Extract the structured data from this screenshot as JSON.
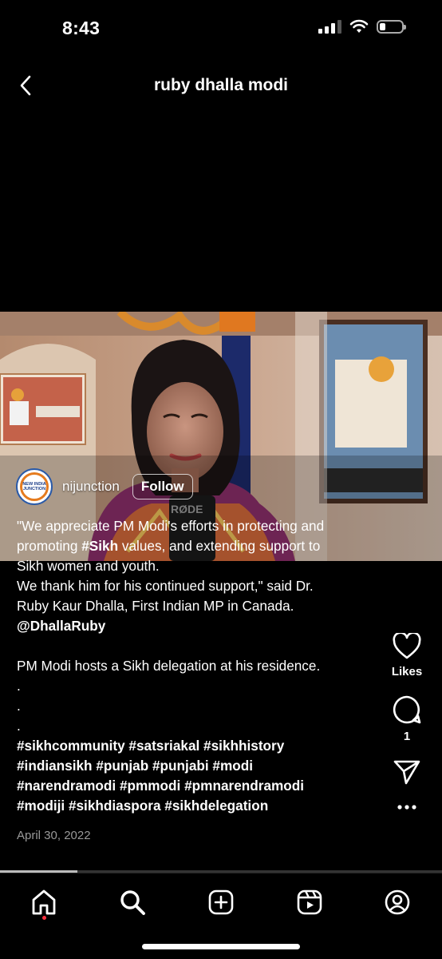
{
  "status_bar": {
    "time": "8:43",
    "signal_bars": 3,
    "battery_level": 0.25
  },
  "header": {
    "title": "ruby dhalla modi",
    "back_icon": "chevron-left-icon"
  },
  "video": {
    "mic_text": "RØDE",
    "progress": 0.175
  },
  "author": {
    "username": "nijunction",
    "follow_label": "Follow",
    "avatar_text": "NEW INDIA JUNCTION"
  },
  "caption": {
    "l1": "\"We appreciate PM Modi's efforts in protecting and",
    "l2_pre": "promoting ",
    "l2_tag": "#Sikh",
    "l2_post": " values, and extending support to",
    "l3": "Sikh women and youth.",
    "l4": "We thank him for his continued support,\" said Dr.",
    "l5": "Ruby Kaur Dhalla, First Indian MP in Canada.",
    "mention": "@DhallaRuby",
    "l7": "PM Modi hosts a Sikh delegation at his residence.",
    "dot": ".",
    "h1": "#sikhcommunity #satsriakal #sikhhistory",
    "h2": "#indiansikh #punjab #punjabi #modi",
    "h3": "#narendramodi #pmmodi #pmnarendramodi",
    "h4": "#modiji #sikhdiaspora #sikhdelegation",
    "date": "April 30, 2022"
  },
  "actions": {
    "likes_label": "Likes",
    "comments_count": "1",
    "like_icon": "heart-icon",
    "comment_icon": "comment-icon",
    "share_icon": "send-icon",
    "more_icon": "more-icon"
  },
  "bottom_nav": [
    "home-icon",
    "search-icon",
    "create-icon",
    "reels-icon",
    "profile-icon"
  ],
  "colors": {
    "background": "#000000",
    "notification_dot": "#ff3040",
    "follow_border": "#ffffff"
  }
}
